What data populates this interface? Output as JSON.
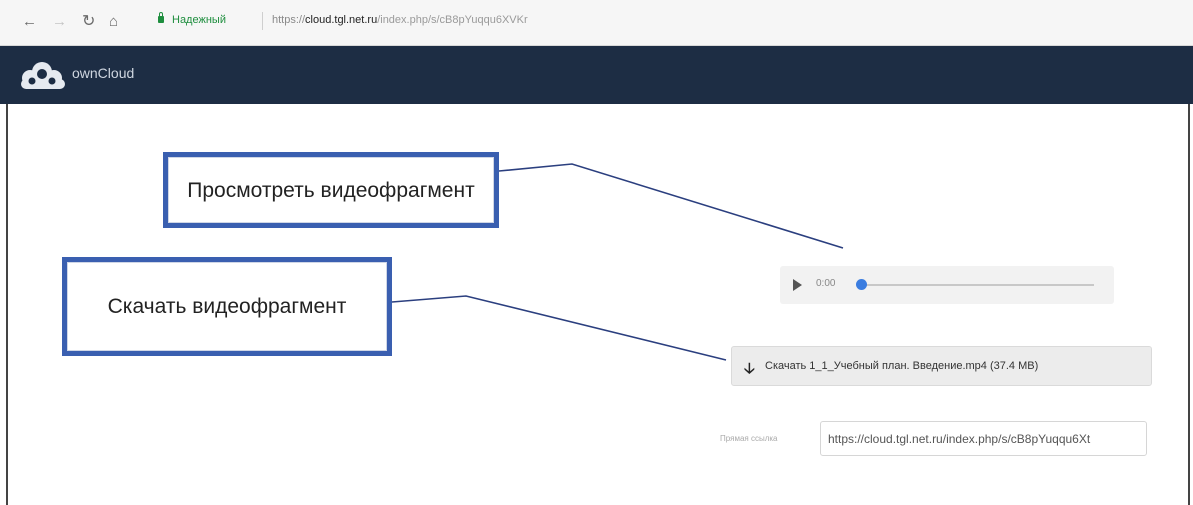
{
  "browser": {
    "back_icon": "back-arrow-icon",
    "forward_icon": "forward-arrow-icon",
    "reload_icon": "reload-icon",
    "home_icon": "home-icon",
    "secure_label": "Надежный",
    "url_scheme": "https://",
    "url_host": "cloud.tgl.net.ru",
    "url_path": "/index.php/s/cB8pYuqqu6XVKr"
  },
  "app": {
    "name": "ownCloud",
    "header_color": "#1d2d44"
  },
  "callouts": {
    "view_video": "Просмотреть видеофрагмент",
    "download_video": "Скачать видеофрагмент",
    "border_color": "#3a5fb0"
  },
  "player": {
    "time": "0:00",
    "play_icon": "play-icon",
    "progress": 0
  },
  "download": {
    "label": "Скачать 1_1_Учебный план. Введение.mp4 (37.4 MB)"
  },
  "direct_link": {
    "label": "Прямая ссылка",
    "value": "https://cloud.tgl.net.ru/index.php/s/cB8pYuqqu6Xt"
  }
}
